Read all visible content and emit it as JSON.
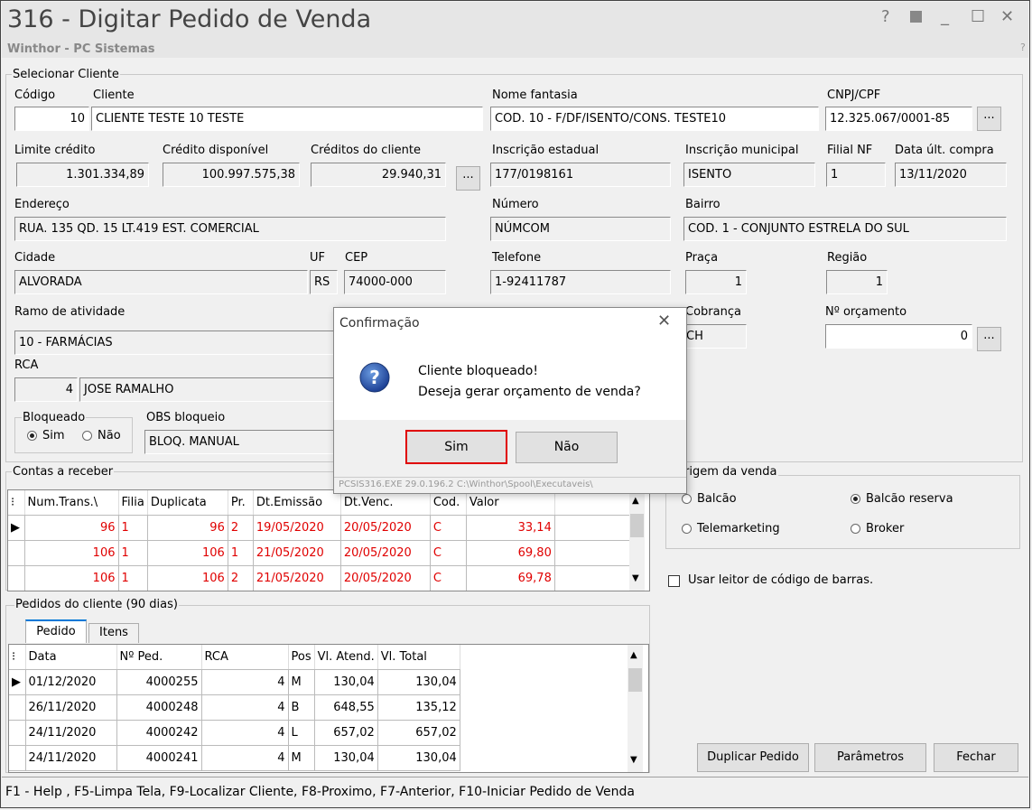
{
  "window": {
    "title": "316 - Digitar Pedido de Venda",
    "subtitle": "Winthor - PC Sistemas",
    "help": "?",
    "minimize": "_",
    "maximize": "☐",
    "close": "✕",
    "extra": "?"
  },
  "cliente": {
    "group_title": "Selecionar Cliente",
    "codigo_label": "Código",
    "codigo": "10",
    "cliente_label": "Cliente",
    "cliente": "CLIENTE TESTE 10 TESTE",
    "fantasia_label": "Nome fantasia",
    "fantasia": "COD. 10 - F/DF/ISENTO/CONS. TESTE10",
    "cnpj_label": "CNPJ/CPF",
    "cnpj": "12.325.067/0001-85",
    "limite_label": "Limite crédito",
    "limite": "1.301.334,89",
    "credito_disp_label": "Crédito disponível",
    "credito_disp": "100.997.575,38",
    "creditos_cli_label": "Créditos do cliente",
    "creditos_cli": "29.940,31",
    "insc_est_label": "Inscrição estadual",
    "insc_est": "177/0198161",
    "insc_mun_label": "Inscrição municipal",
    "insc_mun": "ISENTO",
    "filial_label": "Filial NF",
    "filial": "1",
    "data_ult_label": "Data últ. compra",
    "data_ult": "13/11/2020",
    "endereco_label": "Endereço",
    "endereco": "RUA. 135 QD. 15 LT.419 EST. COMERCIAL",
    "numero_label": "Número",
    "numero": "NÚMCOM",
    "bairro_label": "Bairro",
    "bairro": "COD. 1 - CONJUNTO ESTRELA DO SUL",
    "cidade_label": "Cidade",
    "cidade": "ALVORADA",
    "uf_label": "UF",
    "uf": "RS",
    "cep_label": "CEP",
    "cep": "74000-000",
    "telefone_label": "Telefone",
    "telefone": "1-92411787",
    "praca_label": "Praça",
    "praca": "1",
    "regiao_label": "Região",
    "regiao": "1",
    "ramo_label": "Ramo de atividade",
    "ramo": "10 - FARMÁCIAS",
    "cobranca_label": "Cobrança",
    "cobranca": "CH",
    "orcamento_label": "Nº orçamento",
    "orcamento": "0",
    "rca_label": "RCA",
    "rca_cod": "4",
    "rca_nome": "JOSE RAMALHO",
    "bloqueado_label": "Bloqueado",
    "sim_label": "Sim",
    "nao_label": "Não",
    "obs_label": "OBS bloqueio",
    "obs": "BLOQ. MANUAL",
    "dots": "..."
  },
  "contas": {
    "title": "Contas a receber",
    "headers": [
      "Num.Trans.\\",
      "Filia",
      "Duplicata",
      "Pr.",
      "Dt.Emissão",
      "Dt.Venc.",
      "Cod.",
      "Valor"
    ],
    "rows": [
      [
        "96",
        "1",
        "96",
        "2",
        "19/05/2020",
        "20/05/2020",
        "C",
        "33,14"
      ],
      [
        "106",
        "1",
        "106",
        "1",
        "21/05/2020",
        "20/05/2020",
        "C",
        "69,80"
      ],
      [
        "106",
        "1",
        "106",
        "2",
        "21/05/2020",
        "20/05/2020",
        "C",
        "69,78"
      ]
    ]
  },
  "pedidos": {
    "title": "Pedidos do cliente (90 dias)",
    "tabs": [
      "Pedido",
      "Itens"
    ],
    "headers": [
      "Data",
      "Nº Ped.",
      "RCA",
      "Pos",
      "Vl. Atend.",
      "Vl. Total"
    ],
    "rows": [
      [
        "01/12/2020",
        "4000255",
        "4",
        "M",
        "130,04",
        "130,04"
      ],
      [
        "26/11/2020",
        "4000248",
        "4",
        "B",
        "648,55",
        "135,12"
      ],
      [
        "24/11/2020",
        "4000242",
        "4",
        "L",
        "657,02",
        "657,02"
      ],
      [
        "24/11/2020",
        "4000241",
        "4",
        "M",
        "130,04",
        "130,04"
      ]
    ]
  },
  "origem": {
    "title": "rigem da venda",
    "balcao": "Balcão",
    "balcao_reserva": "Balcão reserva",
    "telemarketing": "Telemarketing",
    "broker": "Broker",
    "selected": "Balcão reserva"
  },
  "leitor": {
    "label": "Usar leitor de código de barras.",
    "checked": false
  },
  "buttons": {
    "duplicar": "Duplicar Pedido",
    "parametros": "Parâmetros",
    "fechar": "Fechar"
  },
  "status": "F1 - Help , F5-Limpa Tela, F9-Localizar Cliente, F8-Proximo, F7-Anterior, F10-Iniciar Pedido de Venda",
  "dialog": {
    "title": "Confirmação",
    "line1": "Cliente bloqueado!",
    "line2": "Deseja gerar orçamento de venda?",
    "sim": "Sim",
    "nao": "Não",
    "footer": "PCSIS316.EXE 29.0.196.2 C:\\Winthor\\Spool\\Executaveis\\"
  }
}
